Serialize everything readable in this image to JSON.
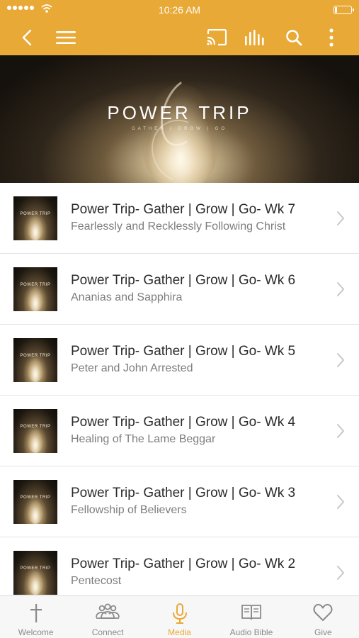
{
  "status_bar": {
    "time": "10:26 AM"
  },
  "hero": {
    "title": "POWER TRIP",
    "subtitle": "GATHER | GROW | GO"
  },
  "thumb_label": "POWER TRIP",
  "episodes": [
    {
      "title": "Power Trip- Gather | Grow | Go- Wk 7",
      "subtitle": "Fearlessly and Recklessly Following Christ"
    },
    {
      "title": "Power Trip- Gather | Grow | Go- Wk 6",
      "subtitle": "Ananias and Sapphira"
    },
    {
      "title": "Power Trip- Gather | Grow | Go- Wk 5",
      "subtitle": "Peter and John Arrested"
    },
    {
      "title": "Power Trip- Gather | Grow | Go- Wk 4",
      "subtitle": "Healing of The Lame Beggar"
    },
    {
      "title": "Power Trip- Gather | Grow | Go- Wk 3",
      "subtitle": "Fellowship of Believers"
    },
    {
      "title": "Power Trip- Gather | Grow | Go- Wk 2",
      "subtitle": "Pentecost"
    }
  ],
  "tabs": [
    {
      "label": "Welcome",
      "icon": "cross-icon"
    },
    {
      "label": "Connect",
      "icon": "people-icon"
    },
    {
      "label": "Media",
      "icon": "microphone-icon",
      "active": true
    },
    {
      "label": "Audio Bible",
      "icon": "book-icon"
    },
    {
      "label": "Give",
      "icon": "heart-icon"
    }
  ],
  "colors": {
    "accent": "#e8a936",
    "tab_inactive": "#8a8a8a"
  }
}
